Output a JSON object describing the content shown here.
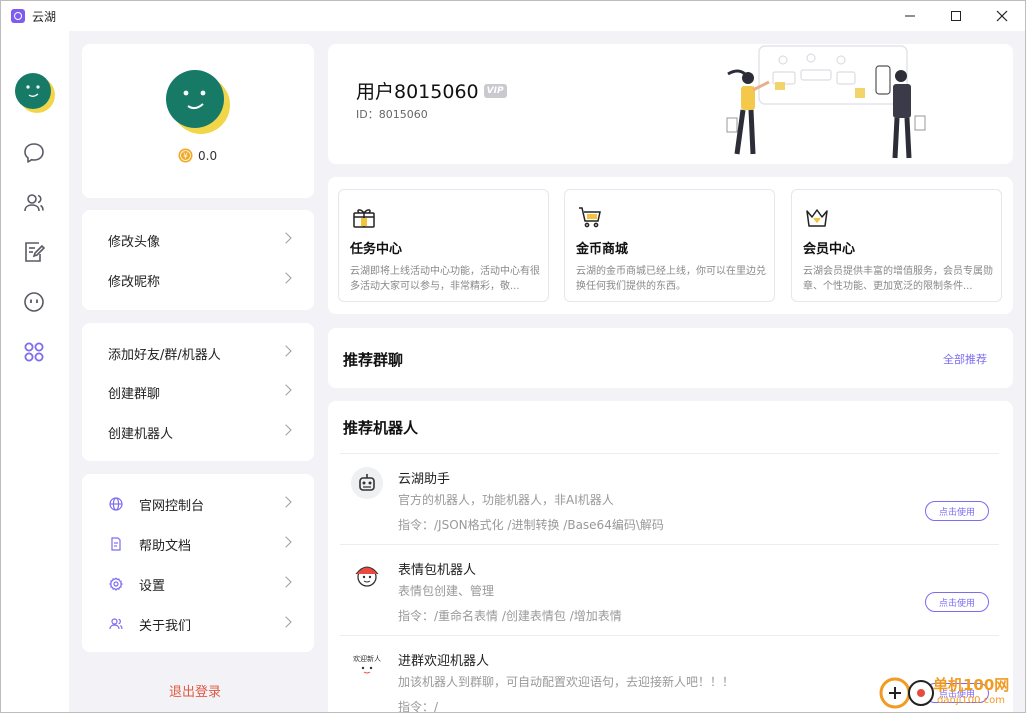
{
  "window": {
    "title": "云湖"
  },
  "colors": {
    "accent": "#7c6cf2",
    "logout": "#e05a43",
    "avatar_teal": "#167a67",
    "avatar_yellow": "#f2d649"
  },
  "rail": {
    "items": [
      {
        "icon": "chat-bubble-icon"
      },
      {
        "icon": "contacts-icon"
      },
      {
        "icon": "notes-edit-icon"
      },
      {
        "icon": "emoji-face-icon"
      },
      {
        "icon": "apps-grid-icon",
        "active": true
      }
    ]
  },
  "profile": {
    "coins": "0.0"
  },
  "menu1": {
    "items": [
      "修改头像",
      "修改昵称"
    ]
  },
  "menu2": {
    "items": [
      "添加好友/群/机器人",
      "创建群聊",
      "创建机器人"
    ]
  },
  "menu3": {
    "items": [
      "官网控制台",
      "帮助文档",
      "设置",
      "关于我们"
    ]
  },
  "logout_label": "退出登录",
  "user": {
    "name": "用户8015060",
    "vip_badge": "VIP",
    "id_line": "ID：8015060"
  },
  "features": [
    {
      "icon": "gift-icon",
      "title": "任务中心",
      "desc": "云湖即将上线活动中心功能，活动中心有很多活动大家可以参与，非常精彩，敬..."
    },
    {
      "icon": "cart-icon",
      "title": "金币商城",
      "desc": "云湖的金币商城已经上线，你可以在里边兑换任何我们提供的东西。"
    },
    {
      "icon": "crown-icon",
      "title": "会员中心",
      "desc": "云湖会员提供丰富的增值服务，会员专属勋章、个性功能、更加宽泛的限制条件..."
    }
  ],
  "recommend_groups": {
    "title": "推荐群聊",
    "link": "全部推荐"
  },
  "recommend_bots": {
    "title": "推荐机器人",
    "use_label": "点击使用",
    "bots": [
      {
        "name": "云湖助手",
        "desc": "官方的机器人，功能机器人，非AI机器人",
        "cmd": "指令：/JSON格式化   /进制转换   /Base64编码\\解码"
      },
      {
        "name": "表情包机器人",
        "desc": "表情包创建、管理",
        "cmd": "指令：/重命名表情   /创建表情包   /增加表情"
      },
      {
        "name": "进群欢迎机器人",
        "desc": "加该机器人到群聊，可自动配置欢迎语句，去迎接新人吧！！！",
        "cmd": "指令：/",
        "avatar_text": "欢迎新人"
      }
    ]
  },
  "watermark": {
    "text": "单机100网",
    "sub": "danji100.com"
  }
}
